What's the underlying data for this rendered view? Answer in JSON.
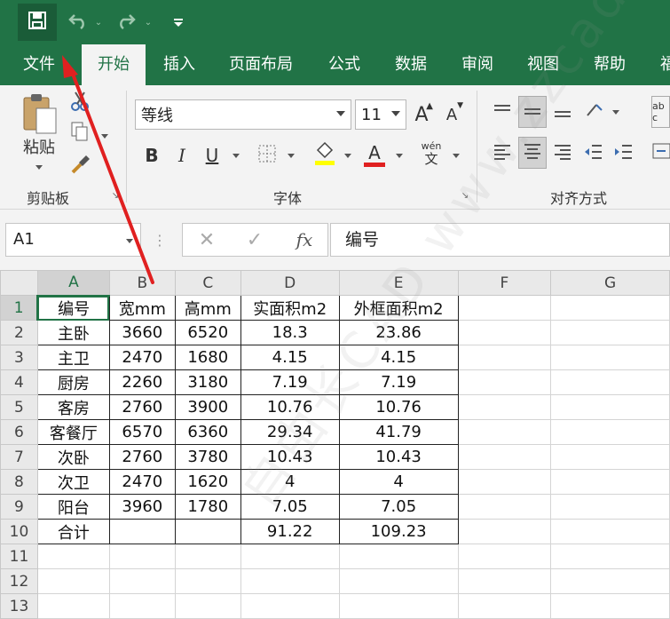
{
  "qat": {
    "save_icon": "save-icon",
    "undo_icon": "undo-icon",
    "redo_icon": "redo-icon",
    "customize_icon": "customize-qat-icon"
  },
  "tabs": [
    "文件",
    "开始",
    "插入",
    "页面布局",
    "公式",
    "数据",
    "审阅",
    "视图",
    "帮助",
    "福"
  ],
  "active_tab": "开始",
  "ribbon": {
    "clipboard": {
      "paste_label": "粘贴",
      "group_label": "剪贴板"
    },
    "font": {
      "font_name": "等线",
      "font_size": "11",
      "bold": "B",
      "italic": "I",
      "underline": "U",
      "font_color": "A",
      "phonetic": "wén",
      "phonetic_char": "文",
      "grow": "A",
      "shrink": "A",
      "group_label": "字体"
    },
    "alignment": {
      "group_label": "对齐方式",
      "wrap_text": "ab c"
    }
  },
  "formula_bar": {
    "name_box": "A1",
    "fx": "fx",
    "content": "编号"
  },
  "watermark": "自由长CAD   www.zzcad.com",
  "columns": [
    "A",
    "B",
    "C",
    "D",
    "E",
    "F",
    "G"
  ],
  "rows": [
    [
      "编号",
      "宽mm",
      "高mm",
      "实面积m2",
      "外框面积m2"
    ],
    [
      "主卧",
      "3660",
      "6520",
      "18.3",
      "23.86"
    ],
    [
      "主卫",
      "2470",
      "1680",
      "4.15",
      "4.15"
    ],
    [
      "厨房",
      "2260",
      "3180",
      "7.19",
      "7.19"
    ],
    [
      "客房",
      "2760",
      "3900",
      "10.76",
      "10.76"
    ],
    [
      "客餐厅",
      "6570",
      "6360",
      "29.34",
      "41.79"
    ],
    [
      "次卧",
      "2760",
      "3780",
      "10.43",
      "10.43"
    ],
    [
      "次卫",
      "2470",
      "1620",
      "4",
      "4"
    ],
    [
      "阳台",
      "3960",
      "1780",
      "7.05",
      "7.05"
    ],
    [
      "合计",
      "",
      "",
      "91.22",
      "109.23"
    ]
  ],
  "row_numbers": [
    "1",
    "2",
    "3",
    "4",
    "5",
    "6",
    "7",
    "8",
    "9",
    "10",
    "11",
    "12",
    "13"
  ],
  "colors": {
    "excel_green": "#217346",
    "arrow_red": "#e02020"
  }
}
